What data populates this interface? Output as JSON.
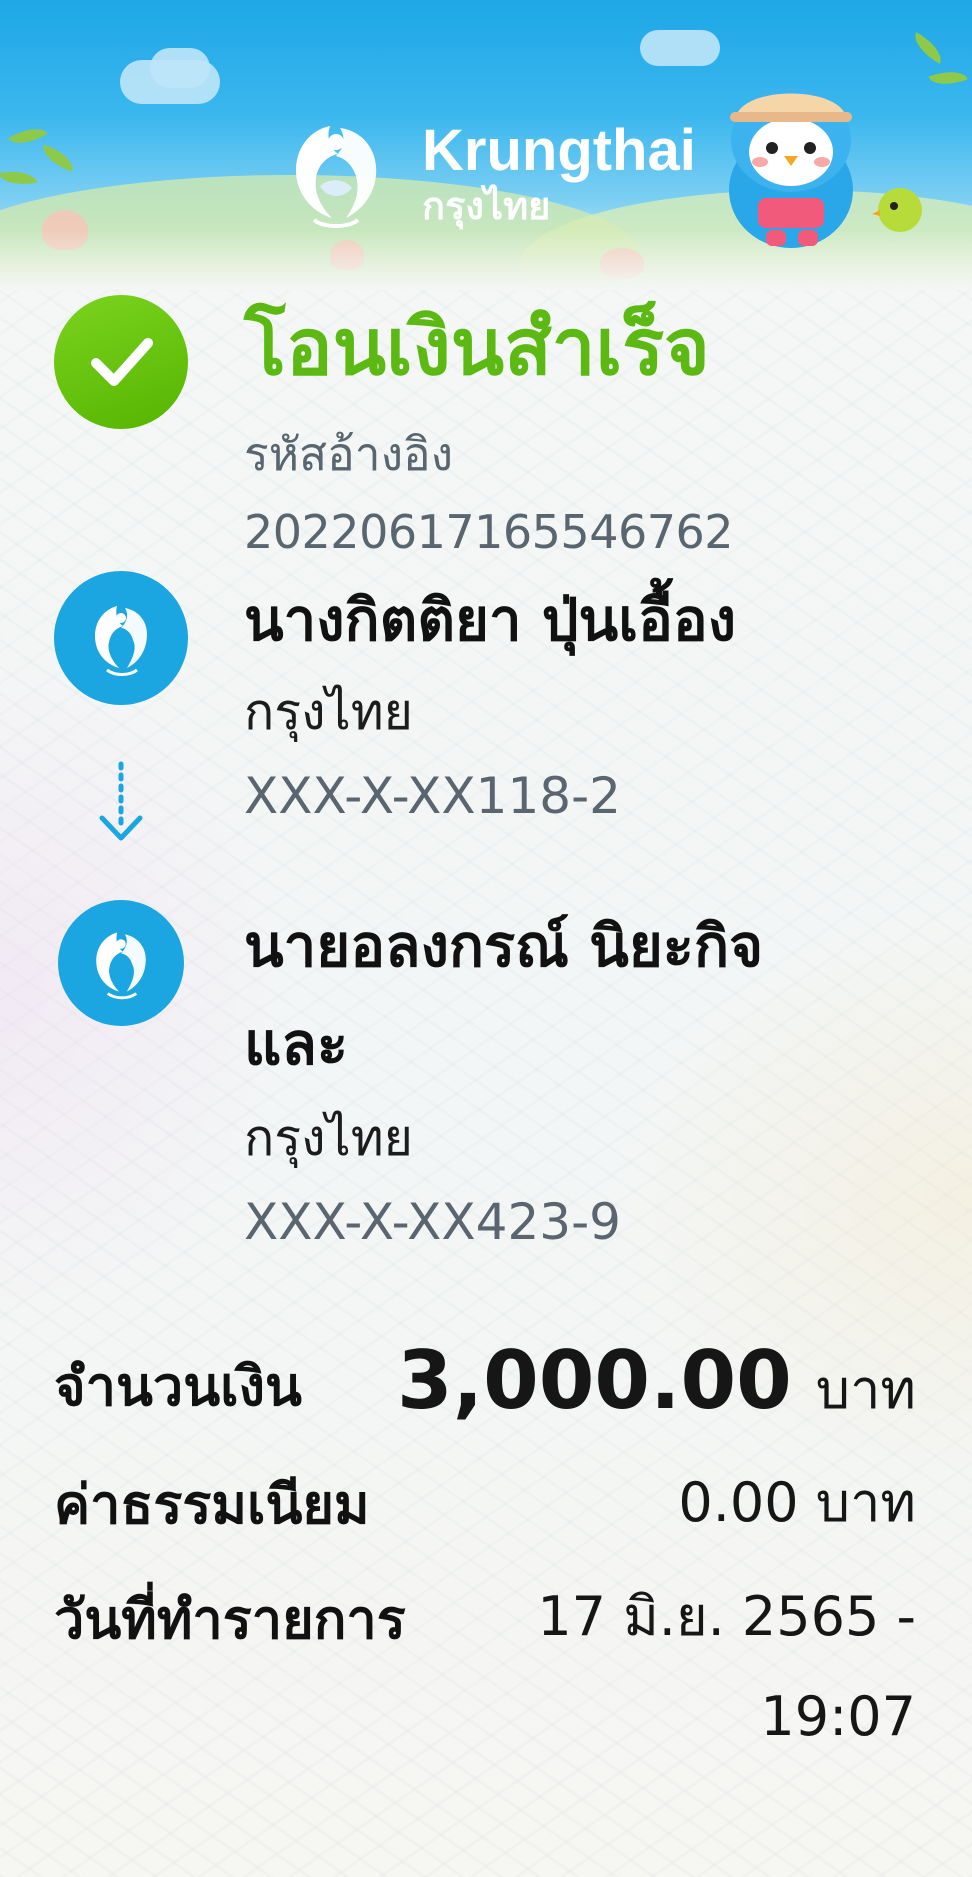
{
  "header": {
    "brand_en": "Krungthai",
    "brand_th": "กรุงไทย"
  },
  "status": {
    "title": "โอนเงินสำเร็จ",
    "icon": "check-icon",
    "color": "#5cb914"
  },
  "reference": {
    "label": "รหัสอ้างอิง",
    "value": "2022061716554676​2"
  },
  "sender": {
    "name": "นางกิตติยา ปุ่นเอื้อง",
    "bank": "กรุงไทย",
    "account": "XXX-X-XX118-2",
    "icon": "krungthai-logo-icon"
  },
  "receiver": {
    "name_line1": "นายอลงกรณ์ นิยะกิจ",
    "name_line2": "และ",
    "bank": "กรุงไทย",
    "account": "XXX-X-XX423-9",
    "icon": "krungthai-logo-icon"
  },
  "details": {
    "amount_label": "จำนวนเงิน",
    "amount_value": "3,000.00",
    "amount_unit": "บาท",
    "fee_label": "ค่าธรรมเนียม",
    "fee_value": "0.00 บาท",
    "date_label": "วันที่ทำรายการ",
    "date_value_line1": "17 มิ.ย. 2565 -",
    "date_value_line2": "19:07"
  },
  "colors": {
    "brand_blue": "#1ba5e1",
    "success_green": "#5cb914",
    "secondary_text": "#59656f"
  }
}
